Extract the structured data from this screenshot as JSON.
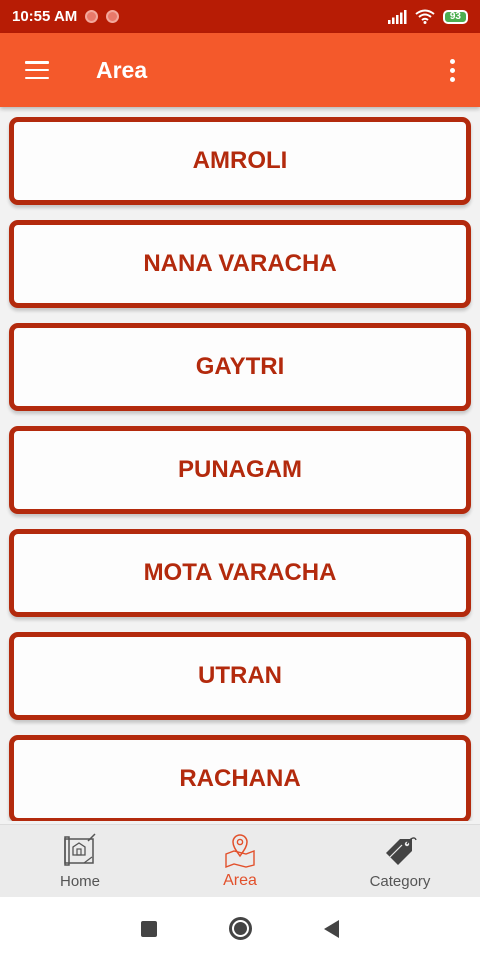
{
  "status_bar": {
    "time": "10:55 AM",
    "battery": "93"
  },
  "app_bar": {
    "title": "Area"
  },
  "areas": [
    {
      "label": "AMROLI"
    },
    {
      "label": "NANA VARACHA"
    },
    {
      "label": "GAYTRI"
    },
    {
      "label": "PUNAGAM"
    },
    {
      "label": "MOTA VARACHA"
    },
    {
      "label": "UTRAN"
    },
    {
      "label": "RACHANA"
    }
  ],
  "bottom_nav": {
    "items": [
      {
        "label": "Home",
        "icon": "blueprint-icon",
        "active": false
      },
      {
        "label": "Area",
        "icon": "map-pin-icon",
        "active": true
      },
      {
        "label": "Category",
        "icon": "tag-icon",
        "active": false
      }
    ]
  },
  "colors": {
    "status_bar": "#b71c05",
    "app_bar": "#f4592b",
    "card_accent": "#b32a0d",
    "nav_active": "#e2502b"
  }
}
